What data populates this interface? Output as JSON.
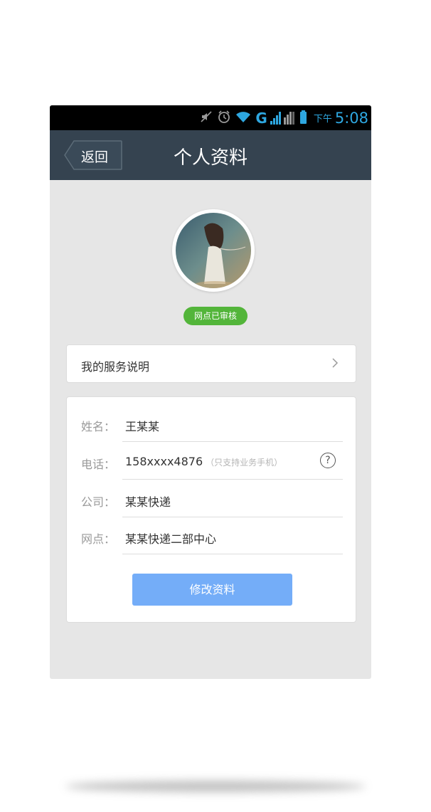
{
  "status_bar": {
    "ampm": "下午",
    "time": "5:08",
    "network": "G",
    "icons": [
      "mute-icon",
      "alarm-icon",
      "wifi-icon",
      "network-g-icon",
      "signal-icon",
      "signal2-icon",
      "battery-icon"
    ]
  },
  "nav": {
    "back_label": "返回",
    "title": "个人资料"
  },
  "profile": {
    "avatar_icon": "avatar-image",
    "badge": "网点已审核"
  },
  "service": {
    "label": "我的服务说明",
    "chevron_icon": "chevron-right-icon"
  },
  "info": {
    "name_label": "姓名：",
    "name_value": "王某某",
    "phone_label": "电话：",
    "phone_value": "158xxxx4876",
    "phone_hint": "（只支持业务手机）",
    "help_icon": "help-icon",
    "help_glyph": "?",
    "company_label": "公司：",
    "company_value": "某某快递",
    "branch_label": "网点：",
    "branch_value": "某某快递二部中心"
  },
  "actions": {
    "edit_label": "修改资料"
  },
  "colors": {
    "navbar": "#354350",
    "badge": "#53b53a",
    "button": "#74adf8",
    "status_accent": "#2ea7e0"
  }
}
